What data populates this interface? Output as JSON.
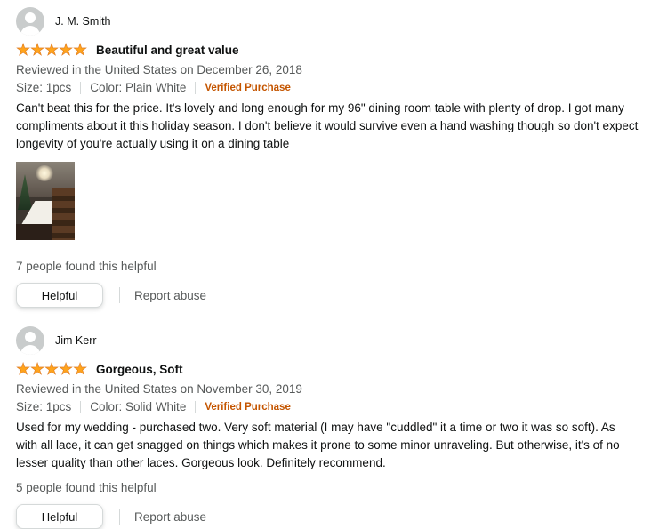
{
  "reviews": [
    {
      "reviewer": "J. M. Smith",
      "rating": 5,
      "title": "Beautiful and great value",
      "date_line": "Reviewed in the United States on December 26, 2018",
      "size": "Size: 1pcs",
      "color": "Color: Plain White",
      "verified": "Verified Purchase",
      "body": "Can't beat this for the price. It's lovely and long enough for my 96\" dining room table with plenty of drop. I got many compliments about it this holiday season. I don't believe it would survive even a hand washing though so don't expect longevity of you're actually using it on a dining table",
      "helpful_count": "7 people found this helpful",
      "helpful_label": "Helpful",
      "report_label": "Report abuse"
    },
    {
      "reviewer": "Jim Kerr",
      "rating": 5,
      "title": "Gorgeous, Soft",
      "date_line": "Reviewed in the United States on November 30, 2019",
      "size": "Size: 1pcs",
      "color": "Color: Solid White",
      "verified": "Verified Purchase",
      "body": "Used for my wedding - purchased two. Very soft material (I may have \"cuddled\" it a time or two it was so soft). As with all lace, it can get snagged on things which makes it prone to some minor unraveling. But otherwise, it's of no lesser quality than other laces. Gorgeous look. Definitely recommend.",
      "helpful_count": "5 people found this helpful",
      "helpful_label": "Helpful",
      "report_label": "Report abuse"
    }
  ],
  "colors": {
    "star": "#ffa41c",
    "verified": "#c45500",
    "muted": "#565959"
  }
}
